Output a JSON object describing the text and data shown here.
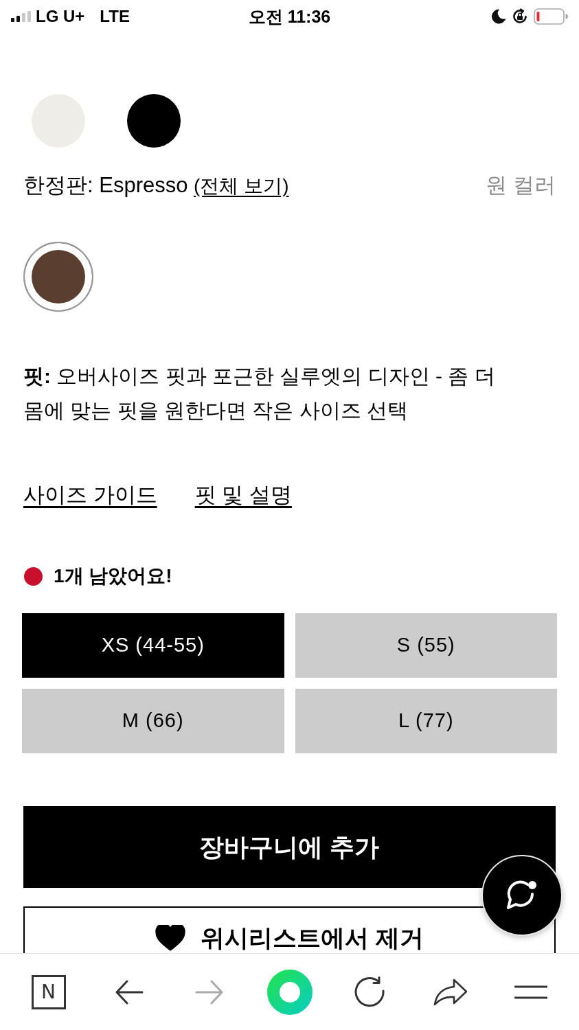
{
  "status_bar": {
    "carrier": "LG U+",
    "network": "LTE",
    "time": "오전 11:36"
  },
  "color_swatches": [
    {
      "color": "#efede7",
      "selected": false
    },
    {
      "color": "#000000",
      "selected": false
    }
  ],
  "limited_edition": {
    "label": "한정판: Espresso",
    "link": "(전체 보기)",
    "note": "원 컬러",
    "swatches": [
      {
        "color": "#5a3e2f",
        "selected": true
      }
    ]
  },
  "fit": {
    "text": "**핏:** 오버사이즈 핏과 포근한 실루엣의 디자인 - 좀 더 몸에 맞는 핏을 원한다면 작은 사이즈 선택"
  },
  "links": [
    "사이즈 가이드",
    "핏 및 설명"
  ],
  "stock": {
    "text": "1개 남았어요!",
    "color": "#c8102e"
  },
  "sizes": [
    {
      "label": "XS (44-55)",
      "selected": true
    },
    {
      "label": "S (55)",
      "selected": false
    },
    {
      "label": "M (66)",
      "selected": false
    },
    {
      "label": "L (77)",
      "selected": false
    }
  ],
  "add_to_cart": {
    "label": "장바구니에 추가"
  },
  "wishlist": {
    "label": "위시리스트에서 제거",
    "in_wishlist": true
  },
  "browser_toolbar": {
    "buttons": [
      {
        "kind": "home",
        "label": "N",
        "disabled": false
      },
      {
        "kind": "back",
        "disabled": false
      },
      {
        "kind": "forward",
        "disabled": true
      },
      {
        "kind": "ring",
        "disabled": false
      },
      {
        "kind": "reload",
        "disabled": false
      },
      {
        "kind": "share",
        "disabled": false
      },
      {
        "kind": "menu",
        "disabled": false
      }
    ]
  }
}
